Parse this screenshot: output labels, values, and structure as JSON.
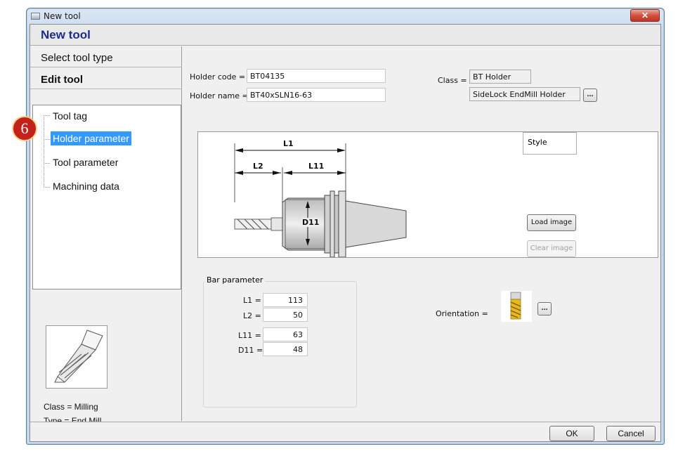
{
  "window": {
    "title": "New tool"
  },
  "header": {
    "title": "New tool"
  },
  "wizard": {
    "steps": [
      {
        "label": "Select tool type"
      },
      {
        "label": "Edit tool"
      }
    ],
    "badge": "6",
    "tree": [
      {
        "label": "Tool tag",
        "selected": false
      },
      {
        "label": "Holder parameter",
        "selected": true
      },
      {
        "label": "Tool parameter",
        "selected": false
      },
      {
        "label": "Machining data",
        "selected": false
      }
    ],
    "info": {
      "class_line": "Class = Milling",
      "type_line": "Type = End Mill"
    }
  },
  "holder": {
    "code_label": "Holder code =",
    "code_value": "BT04135",
    "name_label": "Holder name =",
    "name_value": "BT40xSLN16-63",
    "class_label": "Class =",
    "class_value": "BT Holder",
    "subclass_value": "SideLock EndMill Holder",
    "more_label": "..."
  },
  "diagram": {
    "labels": {
      "l1": "L1",
      "l2": "L2",
      "l11": "L11",
      "d11": "D11"
    },
    "style_label": "Style",
    "load_image": "Load image",
    "clear_image": "Clear image"
  },
  "bar_parameter": {
    "title": "Bar parameter",
    "rows": [
      {
        "label": "L1 =",
        "value": "113"
      },
      {
        "label": "L2 =",
        "value": "50"
      },
      {
        "label": "L11 =",
        "value": "63"
      },
      {
        "label": "D11 =",
        "value": "48"
      }
    ]
  },
  "orientation": {
    "label": "Orientation =",
    "more_label": "..."
  },
  "footer": {
    "ok": "OK",
    "cancel": "Cancel"
  }
}
